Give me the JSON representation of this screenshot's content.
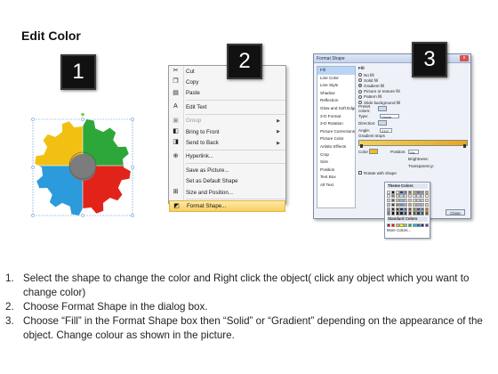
{
  "title": "Edit Color",
  "steps": [
    "1",
    "2",
    "3"
  ],
  "context_menu": {
    "items": [
      {
        "label": "Cut",
        "icon": "scissors-icon",
        "glyph": "✂",
        "disabled": false,
        "submenu": false
      },
      {
        "label": "Copy",
        "icon": "copy-icon",
        "glyph": "❐",
        "disabled": false,
        "submenu": false
      },
      {
        "label": "Paste",
        "icon": "paste-icon",
        "glyph": "▤",
        "disabled": false,
        "submenu": false
      },
      {
        "label": "Edit Text",
        "icon": "edit-text-icon",
        "glyph": "A",
        "disabled": false,
        "submenu": false
      },
      {
        "label": "Group",
        "icon": "group-icon",
        "glyph": "▣",
        "disabled": true,
        "submenu": true
      },
      {
        "label": "Bring to Front",
        "icon": "bring-to-front-icon",
        "glyph": "◧",
        "disabled": false,
        "submenu": true
      },
      {
        "label": "Send to Back",
        "icon": "send-to-back-icon",
        "glyph": "◨",
        "disabled": false,
        "submenu": true
      },
      {
        "label": "Hyperlink...",
        "icon": "hyperlink-icon",
        "glyph": "⊕",
        "disabled": false,
        "submenu": false
      },
      {
        "label": "Save as Picture...",
        "icon": "",
        "glyph": "",
        "disabled": false,
        "submenu": false
      },
      {
        "label": "Set as Default Shape",
        "icon": "",
        "glyph": "",
        "disabled": false,
        "submenu": false
      },
      {
        "label": "Size and Position...",
        "icon": "size-position-icon",
        "glyph": "⊞",
        "disabled": false,
        "submenu": false
      },
      {
        "label": "Format Shape...",
        "icon": "format-shape-icon",
        "glyph": "◩",
        "disabled": false,
        "submenu": false,
        "highlighted": true
      }
    ]
  },
  "dialog": {
    "title": "Format Shape",
    "close_glyph": "x",
    "nav": [
      "Fill",
      "Line Color",
      "Line Style",
      "Shadow",
      "Reflection",
      "Glow and Soft Edges",
      "3-D Format",
      "3-D Rotation",
      "Picture Corrections",
      "Picture Color",
      "Artistic Effects",
      "Crop",
      "Size",
      "Position",
      "Text Box",
      "Alt Text"
    ],
    "fill_heading": "Fill",
    "fill_options": [
      {
        "label": "No fill",
        "checked": false
      },
      {
        "label": "Solid fill",
        "checked": false
      },
      {
        "label": "Gradient fill",
        "checked": true
      },
      {
        "label": "Picture or texture fill",
        "checked": false
      },
      {
        "label": "Pattern fill",
        "checked": false
      },
      {
        "label": "Slide background fill",
        "checked": false
      }
    ],
    "preset_colors_label": "Preset colors:",
    "type_label": "Type:",
    "type_value": "Linear",
    "direction_label": "Direction:",
    "angle_label": "Angle:",
    "angle_value": "270°",
    "gradient_stops_label": "Gradient stops",
    "color_label": "Color",
    "position_label": "Position:",
    "position_value": "0%",
    "brightness_label": "Brightness:",
    "transparency_label": "Transparency:",
    "rotate_label": "Rotate with shape",
    "close_button": "Close"
  },
  "color_popup": {
    "theme_colors_label": "Theme Colors",
    "standard_colors_label": "Standard Colors",
    "more_colors_label": "More Colors...",
    "theme_base": [
      "#ffffff",
      "#000000",
      "#eeece1",
      "#1f497d",
      "#4f81bd",
      "#c0504d",
      "#9bbb59",
      "#8064a2",
      "#4bacc6",
      "#f79646"
    ],
    "theme_rows": [
      [
        "#f2f2f2",
        "#7f7f7f",
        "#ddd9c3",
        "#c6d9f0",
        "#dbe5f1",
        "#f2dcdb",
        "#ebf1dd",
        "#e5e0ec",
        "#dbeef3",
        "#fdeada"
      ],
      [
        "#d8d8d8",
        "#595959",
        "#c4bd97",
        "#8db3e2",
        "#b8cce4",
        "#e5b9b7",
        "#d7e3bc",
        "#ccc1d9",
        "#b7dde8",
        "#fbd5b5"
      ],
      [
        "#bfbfbf",
        "#3f3f3f",
        "#938953",
        "#548dd4",
        "#95b3d7",
        "#d99694",
        "#c3d69b",
        "#b2a2c7",
        "#92cddc",
        "#fac08f"
      ],
      [
        "#a5a5a5",
        "#262626",
        "#494429",
        "#17365d",
        "#366092",
        "#953734",
        "#76923c",
        "#5f497a",
        "#31859b",
        "#e36c09"
      ],
      [
        "#7f7f7f",
        "#0c0c0c",
        "#1d1b10",
        "#0f243e",
        "#244061",
        "#632423",
        "#4f6128",
        "#3f3151",
        "#205867",
        "#974806"
      ]
    ],
    "standard": [
      "#c00000",
      "#ff0000",
      "#ffc000",
      "#ffff00",
      "#92d050",
      "#00b050",
      "#00b0f0",
      "#0070c0",
      "#002060",
      "#7030a0"
    ]
  },
  "gear_colors": {
    "yellow": "#f2c012",
    "green": "#2ea73a",
    "blue": "#2b9bdc",
    "red": "#e2231a",
    "hub": "#7c7c7c"
  },
  "instructions": [
    {
      "num": "1.",
      "text": "Select the shape to change the color and Right click the object( click any object which you want to change color)"
    },
    {
      "num": "2.",
      "text": "Choose Format Shape in the dialog box."
    },
    {
      "num": "3.",
      "text": "Choose “Fill” in the Format Shape box then “Solid” or “Gradient” depending on the appearance of the object. Change colour as shown in the picture."
    }
  ]
}
